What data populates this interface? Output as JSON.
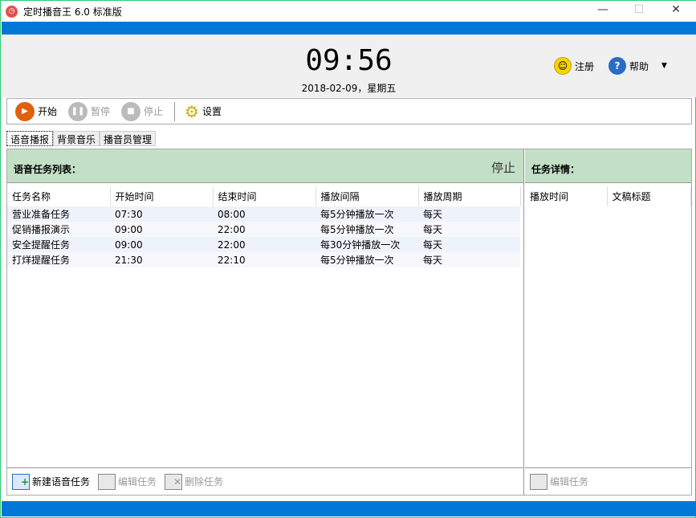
{
  "window": {
    "title": "定时播音王 6.0 标准版"
  },
  "header": {
    "clock": "09:56",
    "date": "2018-02-09，星期五",
    "register": "注册",
    "help": "帮助"
  },
  "toolbar": {
    "start": "开始",
    "pause": "暂停",
    "stop": "停止",
    "settings": "设置"
  },
  "tabs": [
    "语音播报",
    "背景音乐",
    "播音员管理"
  ],
  "tasks": {
    "title": "语音任务列表：",
    "status": "停止",
    "columns": [
      "任务名称",
      "开始时间",
      "结束时间",
      "播放间隔",
      "播放周期"
    ],
    "rows": [
      [
        "营业准备任务",
        "07:30",
        "08:00",
        "每5分钟播放一次",
        "每天"
      ],
      [
        "促销播报演示",
        "09:00",
        "22:00",
        "每5分钟播放一次",
        "每天"
      ],
      [
        "安全提醒任务",
        "09:00",
        "22:00",
        "每30分钟播放一次",
        "每天"
      ],
      [
        "打烊提醒任务",
        "21:30",
        "22:10",
        "每5分钟播放一次",
        "每天"
      ]
    ]
  },
  "details": {
    "title": "任务详情：",
    "columns": [
      "播放时间",
      "文稿标题"
    ]
  },
  "footer": {
    "new_task": "新建语音任务",
    "edit_task": "编辑任务",
    "delete_task": "删除任务",
    "edit_detail": "编辑任务"
  },
  "colors": {
    "accent": "#0078d7",
    "header_green": "#c3e0c6"
  }
}
